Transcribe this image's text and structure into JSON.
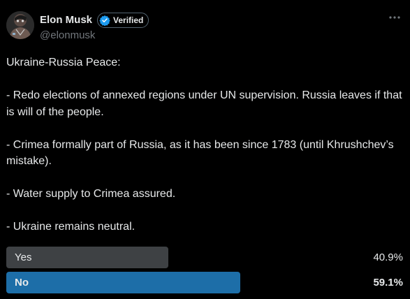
{
  "author": {
    "display_name": "Elon Musk",
    "verified_label": "Verified",
    "handle": "@elonmusk",
    "avatar_icon": "profile-photo"
  },
  "tweet": {
    "lines": [
      "Ukraine-Russia Peace:",
      "- Redo elections of annexed regions under UN supervision. Russia leaves if that is will of the people.",
      "- Crimea formally part of Russia, as it has been since 1783 (until Khrushchev’s mistake).",
      "- Water supply to Crimea assured.",
      "- Ukraine remains neutral."
    ]
  },
  "poll": {
    "options": [
      {
        "label": "Yes",
        "percent_text": "40.9%",
        "percent": 40.9,
        "color": "#3e4144",
        "winner": false
      },
      {
        "label": "No",
        "percent_text": "59.1%",
        "percent": 59.1,
        "color": "#1d6ea8",
        "winner": true
      }
    ]
  },
  "colors": {
    "background": "#000000",
    "text": "#e7e9ea",
    "muted": "#71767b",
    "verified_blue": "#1d9bf0"
  }
}
